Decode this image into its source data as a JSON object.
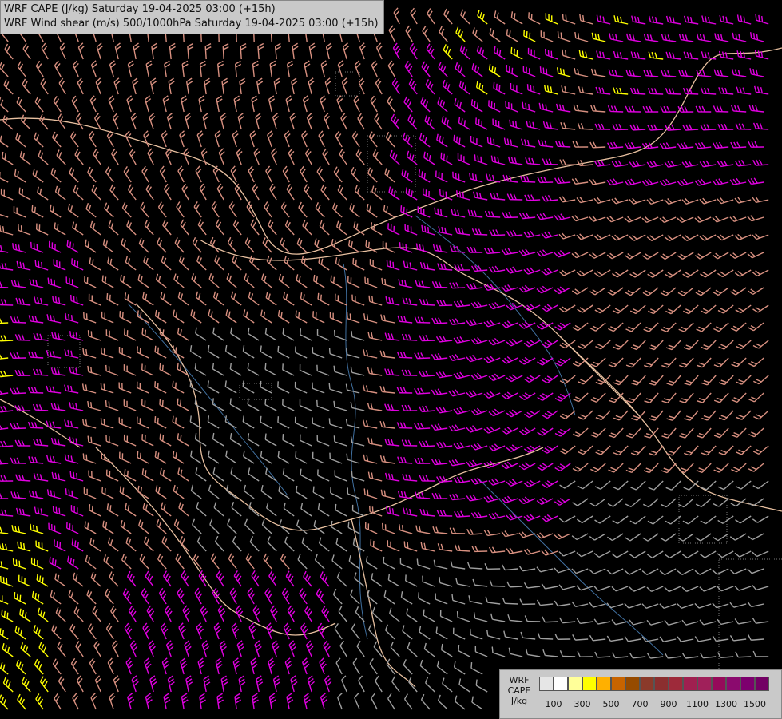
{
  "title": {
    "line1": "WRF CAPE (J/kg) Saturday 19-04-2025 03:00 (+15h)",
    "line2": "WRF Wind shear (m/s) 500/1000hPa Saturday 19-04-2025 03:00 (+15h)"
  },
  "legend": {
    "caption": [
      "WRF",
      "CAPE",
      "J/kg"
    ],
    "colors": [
      "#e6e6e6",
      "#ffffff",
      "#ffff99",
      "#ffff00",
      "#ffb000",
      "#c86400",
      "#964b00",
      "#8b3a2a",
      "#8b2f2f",
      "#9e2a3a",
      "#a02050",
      "#a0205a",
      "#960a5a",
      "#8b0a6e",
      "#7d006e",
      "#730064"
    ],
    "labels": [
      "100",
      "300",
      "500",
      "700",
      "900",
      "1100",
      "1300",
      "1500"
    ]
  },
  "map": {
    "barb_colors": {
      "low": "#a0a0a0",
      "mid": "#d89080",
      "high": "#ee7060",
      "very_high": "#e000e0",
      "extreme": "#ffff00"
    },
    "border_color": "#e8c0a0",
    "river_color": "#4070a0"
  }
}
